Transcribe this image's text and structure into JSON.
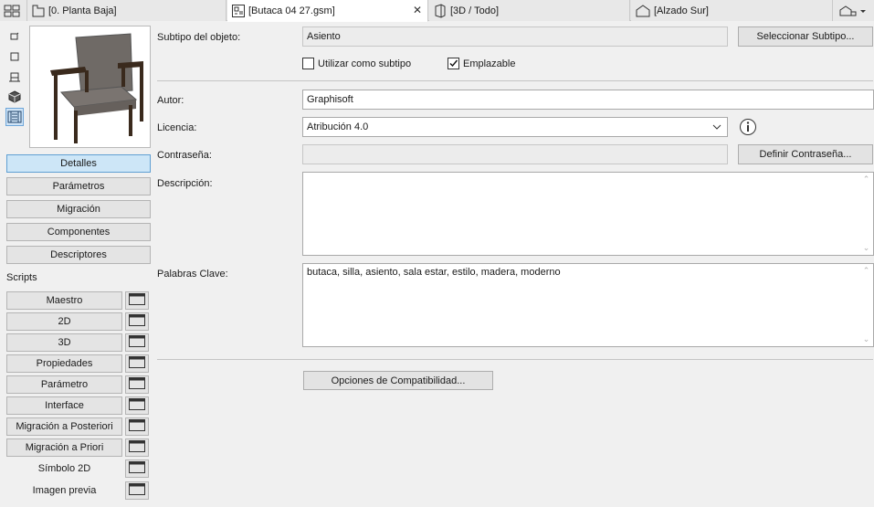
{
  "tabs": [
    {
      "label": "[0. Planta Baja]",
      "icon": "floor-plan-icon"
    },
    {
      "label": "[Butaca 04 27.gsm]",
      "icon": "gsm-object-icon",
      "close": "✕"
    },
    {
      "label": "[3D / Todo]",
      "icon": "3d-view-icon"
    },
    {
      "label": "[Alzado Sur]",
      "icon": "elevation-icon"
    }
  ],
  "left_nav": {
    "buttons": [
      "Detalles",
      "Parámetros",
      "Migración",
      "Componentes",
      "Descriptores"
    ],
    "scripts_label": "Scripts",
    "scripts": [
      "Maestro",
      "2D",
      "3D",
      "Propiedades",
      "Parámetro",
      "Interface",
      "Migración a Posteriori",
      "Migración a Priori",
      "Símbolo 2D",
      "Imagen previa"
    ]
  },
  "details": {
    "subtype_label": "Subtipo del objeto:",
    "subtype_value": "Asiento",
    "select_subtype_button": "Seleccionar Subtipo...",
    "use_as_subtype_label": "Utilizar como subtipo",
    "use_as_subtype_checked": false,
    "placeable_label": "Emplazable",
    "placeable_checked": true,
    "author_label": "Autor:",
    "author_value": "Graphisoft",
    "license_label": "Licencia:",
    "license_value": "Atribución 4.0",
    "password_label": "Contraseña:",
    "password_value": "",
    "define_password_button": "Definir Contraseña...",
    "description_label": "Descripción:",
    "description_value": "",
    "keywords_label": "Palabras Clave:",
    "keywords_value": "butaca, silla, asiento, sala estar, estilo, madera, moderno",
    "compat_button": "Opciones de Compatibilidad..."
  },
  "colors": {
    "accent": "#5f9fd3",
    "active_fill": "#cde6f7"
  }
}
